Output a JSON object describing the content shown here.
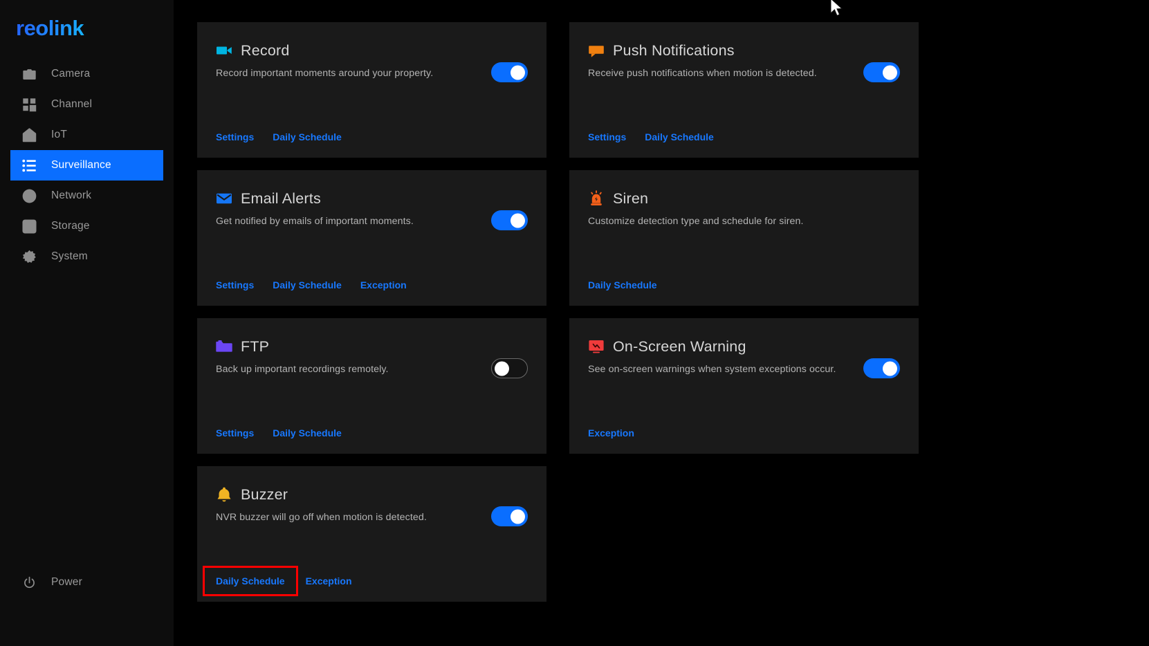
{
  "app": {
    "brand": "reolink",
    "close_label": "✕"
  },
  "sidebar": {
    "items": [
      {
        "label": "Camera",
        "icon": "camera-icon",
        "active": false
      },
      {
        "label": "Channel",
        "icon": "channel-icon",
        "active": false
      },
      {
        "label": "IoT",
        "icon": "iot-icon",
        "active": false
      },
      {
        "label": "Surveillance",
        "icon": "surveillance-icon",
        "active": true
      },
      {
        "label": "Network",
        "icon": "network-icon",
        "active": false
      },
      {
        "label": "Storage",
        "icon": "storage-icon",
        "active": false
      },
      {
        "label": "System",
        "icon": "system-icon",
        "active": false
      }
    ],
    "power": {
      "label": "Power",
      "icon": "power-icon"
    },
    "active_color": "#0a6eff"
  },
  "cards": [
    {
      "title": "Record",
      "description": "Record important moments around your property.",
      "icon": "camcorder-icon",
      "icon_color": "#00b5e2",
      "toggle": {
        "state": "on"
      },
      "links": [
        {
          "label": "Settings",
          "highlighted": false
        },
        {
          "label": "Daily Schedule",
          "highlighted": false
        }
      ]
    },
    {
      "title": "Push Notifications",
      "description": "Receive push notifications when motion is detected.",
      "icon": "speech-bubble-icon",
      "icon_color": "#f08010",
      "toggle": {
        "state": "on"
      },
      "links": [
        {
          "label": "Settings",
          "highlighted": false
        },
        {
          "label": "Daily Schedule",
          "highlighted": false
        }
      ]
    },
    {
      "title": "Email Alerts",
      "description": "Get notified by emails of important moments.",
      "icon": "envelope-icon",
      "icon_color": "#1576f5",
      "toggle": {
        "state": "on"
      },
      "links": [
        {
          "label": "Settings",
          "highlighted": false
        },
        {
          "label": "Daily Schedule",
          "highlighted": false
        },
        {
          "label": "Exception",
          "highlighted": false
        }
      ]
    },
    {
      "title": "Siren",
      "description": "Customize detection type and schedule for siren.",
      "icon": "siren-icon",
      "icon_color": "#f4601a",
      "toggle": {
        "state": "none"
      },
      "links": [
        {
          "label": "Daily Schedule",
          "highlighted": false
        }
      ]
    },
    {
      "title": "FTP",
      "description": "Back up important recordings remotely.",
      "icon": "folder-icon",
      "icon_color": "#6b46f5",
      "toggle": {
        "state": "off"
      },
      "links": [
        {
          "label": "Settings",
          "highlighted": false
        },
        {
          "label": "Daily Schedule",
          "highlighted": false
        }
      ]
    },
    {
      "title": "On-Screen Warning",
      "description": "See on-screen warnings when system exceptions occur.",
      "icon": "monitor-warning-icon",
      "icon_color": "#ef3b3b",
      "toggle": {
        "state": "on"
      },
      "links": [
        {
          "label": "Exception",
          "highlighted": false
        }
      ]
    },
    {
      "title": "Buzzer",
      "description": "NVR buzzer will go off when motion is detected.",
      "icon": "bell-icon",
      "icon_color": "#f0b323",
      "toggle": {
        "state": "on"
      },
      "links": [
        {
          "label": "Daily Schedule",
          "highlighted": true
        },
        {
          "label": "Exception",
          "highlighted": false
        }
      ]
    }
  ],
  "theme": {
    "page_bg": "#000000",
    "sidebar_bg": "#0d0d0d",
    "card_bg": "#1a1a1a",
    "link_color": "#1878ff",
    "toggle_on": "#0a6eff",
    "highlight_box": "#ff0000"
  }
}
